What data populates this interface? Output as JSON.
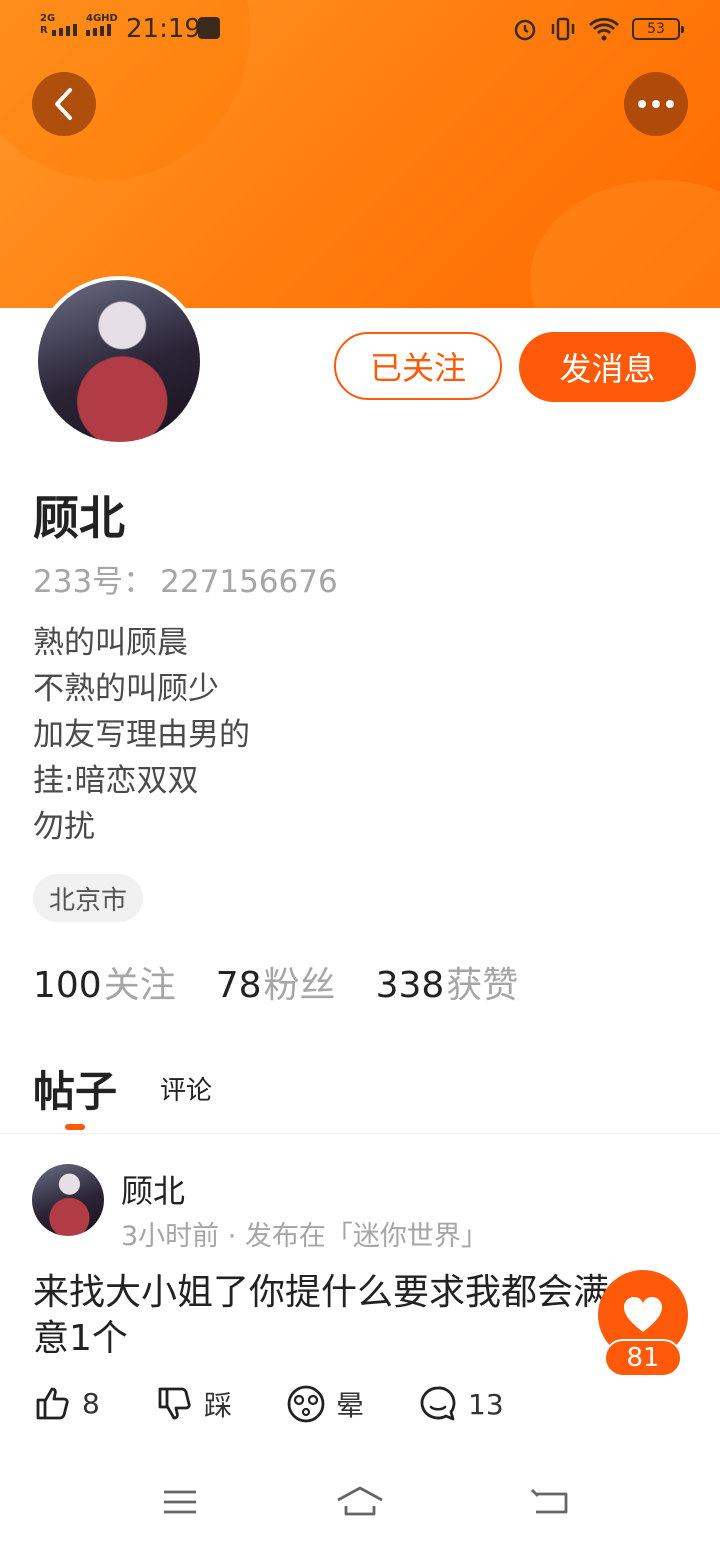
{
  "status_bar": {
    "signal1_top": "2G",
    "signal1_bottom": "R",
    "signal2": "4GHD",
    "time": "21:19",
    "battery": "53"
  },
  "profile": {
    "name": "顾北",
    "id_label": "233号：",
    "id_value": "227156676",
    "bio": [
      "熟的叫顾晨",
      "不熟的叫顾少",
      "加友写理由男的",
      "挂:暗恋双双",
      "勿扰"
    ],
    "location": "北京市",
    "follow_button": "已关注",
    "message_button": "发消息"
  },
  "stats": {
    "following_count": "100",
    "following_label": "关注",
    "fans_count": "78",
    "fans_label": "粉丝",
    "likes_count": "338",
    "likes_label": "获赞"
  },
  "tabs": {
    "posts": "帖子",
    "comments": "评论"
  },
  "post": {
    "author": "顾北",
    "meta": "3小时前 · 发布在「迷你世界」",
    "text": "来找大小姐了你提什么要求我都会满意1个",
    "upvotes": "8",
    "downvote_label": "踩",
    "dizzy_label": "晕",
    "comments": "13",
    "like_count": "81"
  },
  "colors": {
    "accent": "#ff5a0a",
    "header_gradient_start": "#ff9a2a",
    "header_gradient_end": "#ff6a00"
  },
  "icons": [
    "back-arrow-icon",
    "more-dots-icon",
    "thumb-up-icon",
    "thumb-down-icon",
    "dizzy-face-icon",
    "comment-bubble-icon",
    "heart-icon",
    "menu-icon",
    "home-icon",
    "return-icon",
    "alarm-icon",
    "vibrate-icon",
    "wifi-icon"
  ]
}
